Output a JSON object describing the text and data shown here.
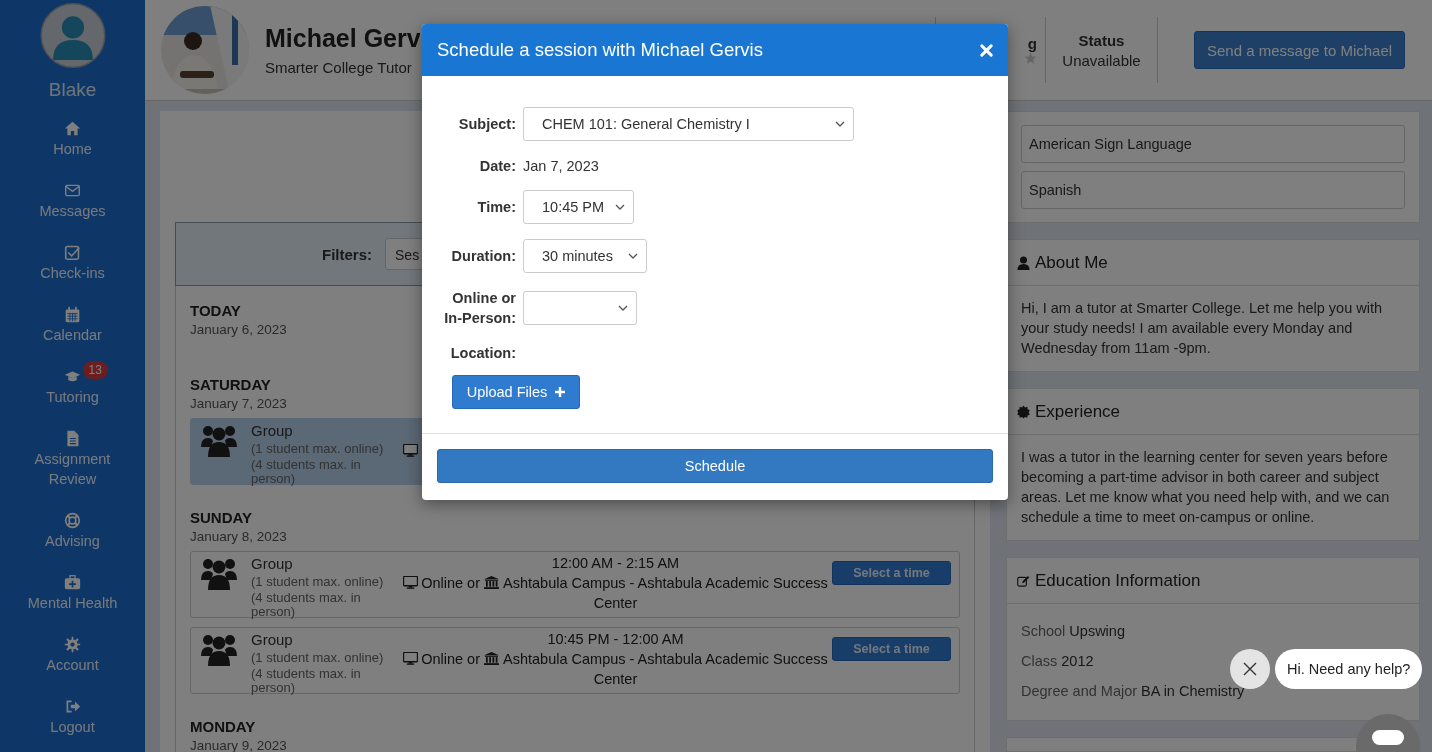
{
  "sidebar": {
    "user": "Blake",
    "items": [
      {
        "label": "Home"
      },
      {
        "label": "Messages"
      },
      {
        "label": "Check-ins"
      },
      {
        "label": "Calendar"
      },
      {
        "label": "Tutoring",
        "badge": "13"
      },
      {
        "label": "Assignment Review"
      },
      {
        "label": "Advising"
      },
      {
        "label": "Mental Health"
      },
      {
        "label": "Account"
      },
      {
        "label": "Logout"
      }
    ]
  },
  "header": {
    "name": "Michael Gerv",
    "subtitle": "Smarter College Tutor",
    "rating_label": "g",
    "status_label": "Status",
    "status": "Unavailable",
    "message_button": "Send a message to Michael"
  },
  "filters": {
    "label": "Filters:",
    "select": "Ses"
  },
  "days": [
    {
      "day": "TODAY",
      "date": "January 6, 2023"
    },
    {
      "day": "SATURDAY",
      "date": "January 7, 2023",
      "sessions": [
        {
          "title": "Group",
          "lines": [
            "(1 student max. online)",
            "(4 students max. in person)"
          ],
          "selected": true
        }
      ]
    },
    {
      "day": "SUNDAY",
      "date": "January 8, 2023",
      "sessions": [
        {
          "title": "Group",
          "lines": [
            "(1 student max. online)",
            "(4 students max. in person)"
          ],
          "selected": false,
          "time": "12:00 AM - 2:15 AM",
          "mode": "Online or",
          "location": "Ashtabula Campus - Ashtabula Academic Success Center",
          "button": "Select a time"
        },
        {
          "title": "Group",
          "lines": [
            "(1 student max. online)",
            "(4 students max. in person)"
          ],
          "selected": false,
          "time": "10:45 PM - 12:00 AM",
          "mode": "Online or",
          "location": "Ashtabula Campus - Ashtabula Academic Success Center",
          "button": "Select a time"
        }
      ]
    },
    {
      "day": "MONDAY",
      "date": "January 9, 2023"
    }
  ],
  "right": {
    "languages": [
      "American Sign Language",
      "Spanish"
    ],
    "about": {
      "title": "About Me",
      "text": "Hi, I am a tutor at Smarter College. Let me help you with your study needs! I am available every Monday and Wednesday from 11am -9pm."
    },
    "experience": {
      "title": "Experience",
      "text": "I was a tutor in the learning center for seven years before becoming a part-time advisor in both career and subject areas. Let me know what you need help with, and we can schedule a time to meet on-campus or online."
    },
    "education": {
      "title": "Education Information",
      "items": [
        {
          "label": "School",
          "value": "Upswing"
        },
        {
          "label": "Class",
          "value": "2012"
        },
        {
          "label": "Degree and Major",
          "value": "BA in Chemistry"
        }
      ]
    }
  },
  "modal": {
    "title": "Schedule a session with Michael Gervis",
    "fields": [
      {
        "kind": "select",
        "label": "Subject:",
        "value": "CHEM 101: General Chemistry I"
      },
      {
        "kind": "text",
        "label": "Date:",
        "value": "Jan 7, 2023"
      },
      {
        "kind": "select",
        "label": "Time:",
        "value": "10:45 PM"
      },
      {
        "kind": "select",
        "label": "Duration:",
        "value": "30 minutes"
      },
      {
        "kind": "select",
        "label": "Online or In-Person:"
      },
      {
        "kind": "label",
        "label": "Location:"
      }
    ],
    "upload_button": "Upload Files",
    "schedule_button": "Schedule"
  },
  "chat": {
    "message": "Hi. Need any help?"
  }
}
